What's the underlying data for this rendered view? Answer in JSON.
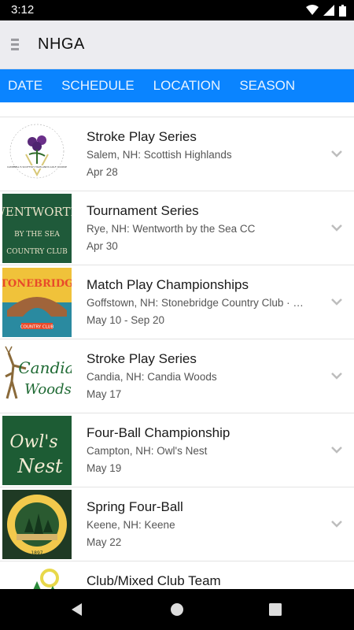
{
  "status_bar": {
    "time": "3:12"
  },
  "app_bar": {
    "title": "NHGA"
  },
  "tabs": [
    {
      "label": "DATE"
    },
    {
      "label": "SCHEDULE"
    },
    {
      "label": "LOCATION"
    },
    {
      "label": "SEASON"
    }
  ],
  "events": [
    {
      "title": "Stroke Play Series",
      "location": "Salem, NH: Scottish Highlands",
      "date": "Apr 28",
      "logo": "scottish-highlands-logo",
      "logo_text": "CAMPBELL'S SCOTTISH HIGHLANDS GOLF COURSE"
    },
    {
      "title": "Tournament Series",
      "location": "Rye, NH: Wentworth by the Sea CC",
      "date": "Apr 30",
      "logo": "wentworth-logo",
      "logo_text": "WENTWORTH BY THE SEA COUNTRY CLUB"
    },
    {
      "title": "Match Play Championships",
      "location": "Goffstown, NH: Stonebridge Country Club · Manch...",
      "date": "May 10 - Sep 20",
      "logo": "stonebridge-logo",
      "logo_text": "STONEBRIDGE COUNTRY CLUB"
    },
    {
      "title": "Stroke Play Series",
      "location": "Candia, NH: Candia Woods",
      "date": "May 17",
      "logo": "candia-woods-logo",
      "logo_text": "Candia Woods"
    },
    {
      "title": "Four-Ball Championship",
      "location": "Campton, NH: Owl's Nest",
      "date": "May 19",
      "logo": "owls-nest-logo",
      "logo_text": "Owl's Nest"
    },
    {
      "title": "Spring Four-Ball",
      "location": "Keene, NH: Keene",
      "date": "May 22",
      "logo": "keene-cc-logo",
      "logo_text": "KEENE COUNTRY CLUB 1897"
    },
    {
      "title": "Club/Mixed Club Team",
      "location": "",
      "date": "",
      "logo": "club-team-logo",
      "logo_text": ""
    }
  ],
  "colors": {
    "tab_bar": "#0a84ff",
    "app_bar": "#ececf0",
    "wentworth_green": "#1f5a3a",
    "owls_nest_green": "#1d5c34"
  },
  "icons": {
    "menu": "hamburger-icon",
    "expand": "chevron-down-icon",
    "wifi": "wifi-icon",
    "signal": "signal-icon",
    "battery": "battery-icon",
    "back": "back-icon",
    "home": "home-icon",
    "recents": "recents-icon"
  }
}
